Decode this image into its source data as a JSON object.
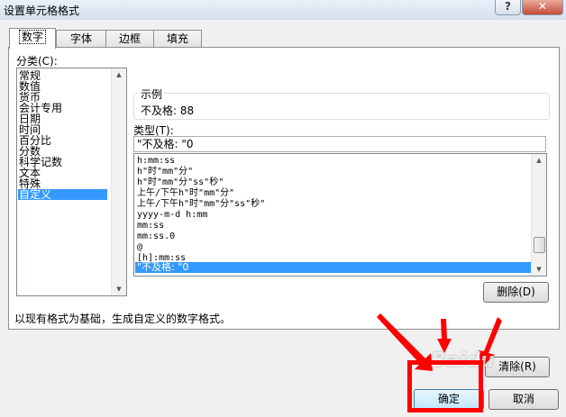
{
  "window": {
    "title": "设置单元格格式",
    "help_glyph": "?",
    "close_glyph": "✕"
  },
  "tabs": [
    {
      "label": "数字",
      "active": true
    },
    {
      "label": "字体",
      "active": false
    },
    {
      "label": "边框",
      "active": false
    },
    {
      "label": "填充",
      "active": false
    }
  ],
  "category": {
    "label": "分类(C):",
    "items": [
      "常规",
      "数值",
      "货币",
      "会计专用",
      "日期",
      "时间",
      "百分比",
      "分数",
      "科学记数",
      "文本",
      "特殊",
      "自定义"
    ],
    "selected": "自定义"
  },
  "sample": {
    "label": "示例",
    "value": "不及格: 88"
  },
  "type": {
    "label": "类型(T):",
    "input_value": "\"不及格: \"0",
    "items": [
      "h:mm:ss",
      "h\"时\"mm\"分\"",
      "h\"时\"mm\"分\"ss\"秒\"",
      "上午/下午h\"时\"mm\"分\"",
      "上午/下午h\"时\"mm\"分\"ss\"秒\"",
      "yyyy-m-d h:mm",
      "mm:ss",
      "mm:ss.0",
      "@",
      "[h]:mm:ss",
      "\"不及格: \"0"
    ],
    "selected": "\"不及格: \"0"
  },
  "buttons": {
    "delete": "删除(D)",
    "clear": "清除(R)",
    "ok": "确定",
    "cancel": "取消"
  },
  "description": "以现有格式为基础，生成自定义的数字格式。",
  "scroll_arrows": {
    "up": "▲",
    "down": "▼"
  },
  "watermark": "Baidu"
}
